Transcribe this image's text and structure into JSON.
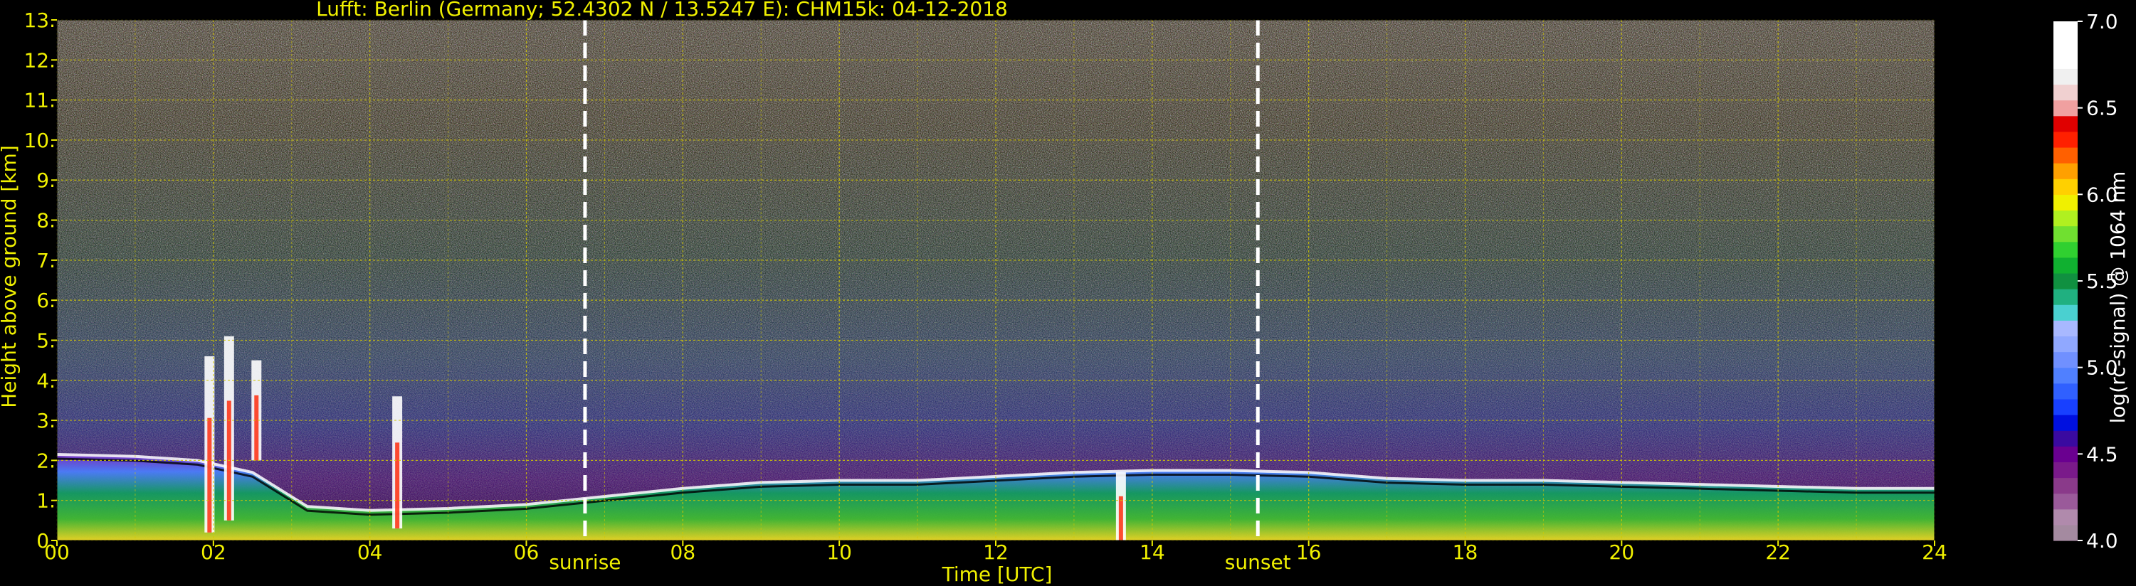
{
  "chart_data": {
    "type": "heatmap",
    "title": "Lufft: Berlin (Germany; 52.4302 N / 13.5247 E):    CHM15k: 04-12-2018",
    "xlabel": "Time [UTC]",
    "ylabel": "Height above ground [km]",
    "colorbar_label": "log(rc-signal) @ 1064 nm",
    "xlim": [
      0,
      24
    ],
    "ylim": [
      0,
      13
    ],
    "x_ticks": [
      0,
      2,
      4,
      6,
      8,
      10,
      12,
      14,
      16,
      18,
      20,
      22,
      24
    ],
    "x_tick_labels": [
      "00",
      "02",
      "04",
      "06",
      "08",
      "10",
      "12",
      "14",
      "16",
      "18",
      "20",
      "22",
      "24"
    ],
    "y_ticks": [
      0,
      1,
      2,
      3,
      4,
      5,
      6,
      7,
      8,
      9,
      10,
      11,
      12,
      13
    ],
    "y_tick_labels": [
      "0.",
      "1.",
      "2.",
      "3.",
      "4.",
      "5.",
      "6.",
      "7.",
      "8.",
      "9.",
      "10.",
      "11.",
      "12.",
      "13."
    ],
    "colorbar_range": [
      4.0,
      7.0
    ],
    "colorbar_ticks": [
      4.0,
      4.5,
      5.0,
      5.5,
      6.0,
      6.5,
      7.0
    ],
    "colorbar_tick_labels": [
      "4.0",
      "4.5",
      "5.0",
      "5.5",
      "6.0",
      "6.5",
      "7.0"
    ],
    "colorbar_colors": [
      "#a48aa0",
      "#b08aac",
      "#9a5a9a",
      "#8a3a8a",
      "#7a1a8a",
      "#6a0090",
      "#3a0aa0",
      "#0010e0",
      "#1840ff",
      "#3060ff",
      "#5080ff",
      "#7090ff",
      "#90a8ff",
      "#a8b8ff",
      "#4ad0d0",
      "#20b080",
      "#109040",
      "#10b030",
      "#30d030",
      "#70e030",
      "#b0f020",
      "#f0f000",
      "#ffd000",
      "#ffa000",
      "#ff6000",
      "#ff2000",
      "#e00000",
      "#f0a0a0",
      "#f0d0d0",
      "#f0f0f0",
      "#ffffff",
      "#ffffff",
      "#ffffff"
    ],
    "annotations": [
      {
        "label": "sunrise",
        "x": 6.75
      },
      {
        "label": "sunset",
        "x": 15.35
      }
    ],
    "aerosol_layer_top_km": [
      {
        "x": 0.0,
        "y": 2.15
      },
      {
        "x": 1.0,
        "y": 2.1
      },
      {
        "x": 1.8,
        "y": 2.0
      },
      {
        "x": 2.5,
        "y": 1.7
      },
      {
        "x": 3.2,
        "y": 0.85
      },
      {
        "x": 4.0,
        "y": 0.75
      },
      {
        "x": 5.0,
        "y": 0.8
      },
      {
        "x": 6.0,
        "y": 0.9
      },
      {
        "x": 6.75,
        "y": 1.05
      },
      {
        "x": 8.0,
        "y": 1.3
      },
      {
        "x": 9.0,
        "y": 1.45
      },
      {
        "x": 10.0,
        "y": 1.5
      },
      {
        "x": 11.0,
        "y": 1.5
      },
      {
        "x": 12.0,
        "y": 1.6
      },
      {
        "x": 13.0,
        "y": 1.7
      },
      {
        "x": 14.0,
        "y": 1.75
      },
      {
        "x": 15.0,
        "y": 1.75
      },
      {
        "x": 16.0,
        "y": 1.7
      },
      {
        "x": 17.0,
        "y": 1.55
      },
      {
        "x": 18.0,
        "y": 1.5
      },
      {
        "x": 19.0,
        "y": 1.5
      },
      {
        "x": 20.0,
        "y": 1.45
      },
      {
        "x": 21.0,
        "y": 1.4
      },
      {
        "x": 22.0,
        "y": 1.35
      },
      {
        "x": 23.0,
        "y": 1.3
      },
      {
        "x": 24.0,
        "y": 1.3
      }
    ],
    "cloud_events": [
      {
        "x": 1.95,
        "y_bottom": 0.2,
        "y_top": 4.6
      },
      {
        "x": 2.2,
        "y_bottom": 0.5,
        "y_top": 5.1
      },
      {
        "x": 2.55,
        "y_bottom": 2.0,
        "y_top": 4.5
      },
      {
        "x": 4.35,
        "y_bottom": 0.3,
        "y_top": 3.6
      },
      {
        "x": 13.6,
        "y_bottom": 0.0,
        "y_top": 1.7
      }
    ],
    "grid": true,
    "grid_color": "#d4c800",
    "accent_text_color": "#f0f000",
    "colorbar_text_color": "#ffffff",
    "marker_line_color": "#ffffff"
  }
}
